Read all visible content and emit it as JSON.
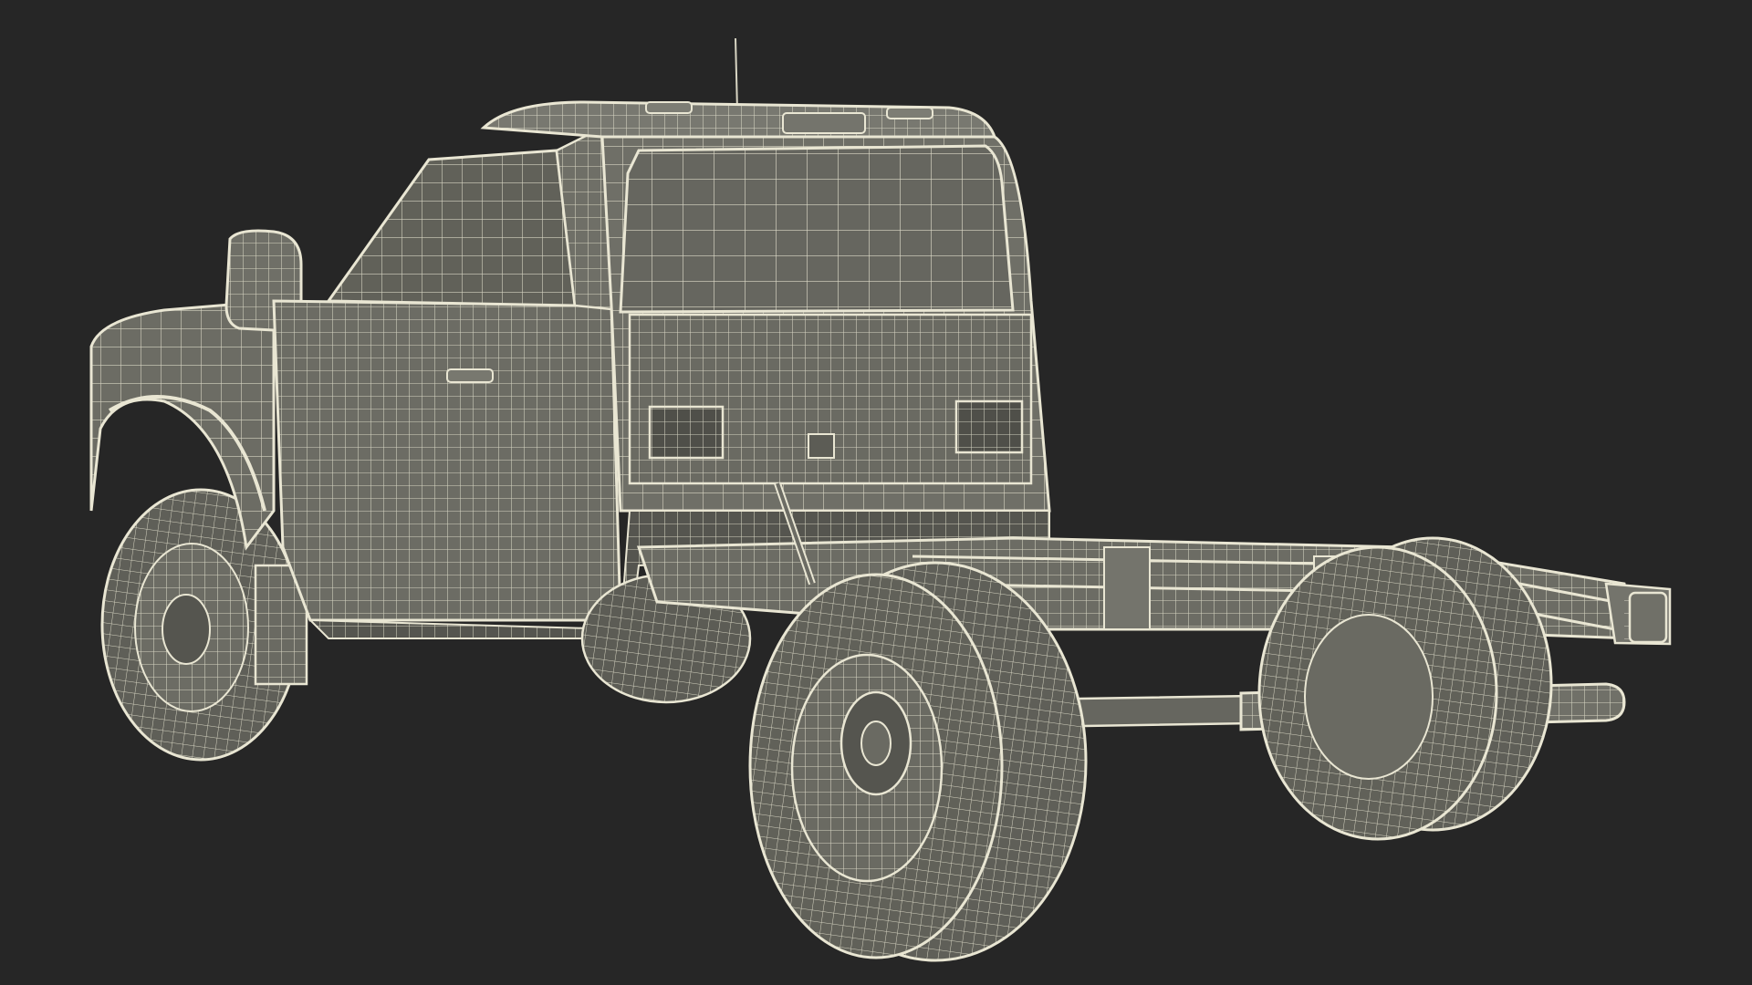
{
  "scene": {
    "background_color": "#262626",
    "model_fill": "#6f6f67",
    "model_fill_dark": "#5a5a53",
    "model_fill_light": "#7d7d74",
    "wire_color": "#e9e6d3",
    "wire_color_faint": "#c9c6b4",
    "shading": "wireframe-on-shaded"
  }
}
